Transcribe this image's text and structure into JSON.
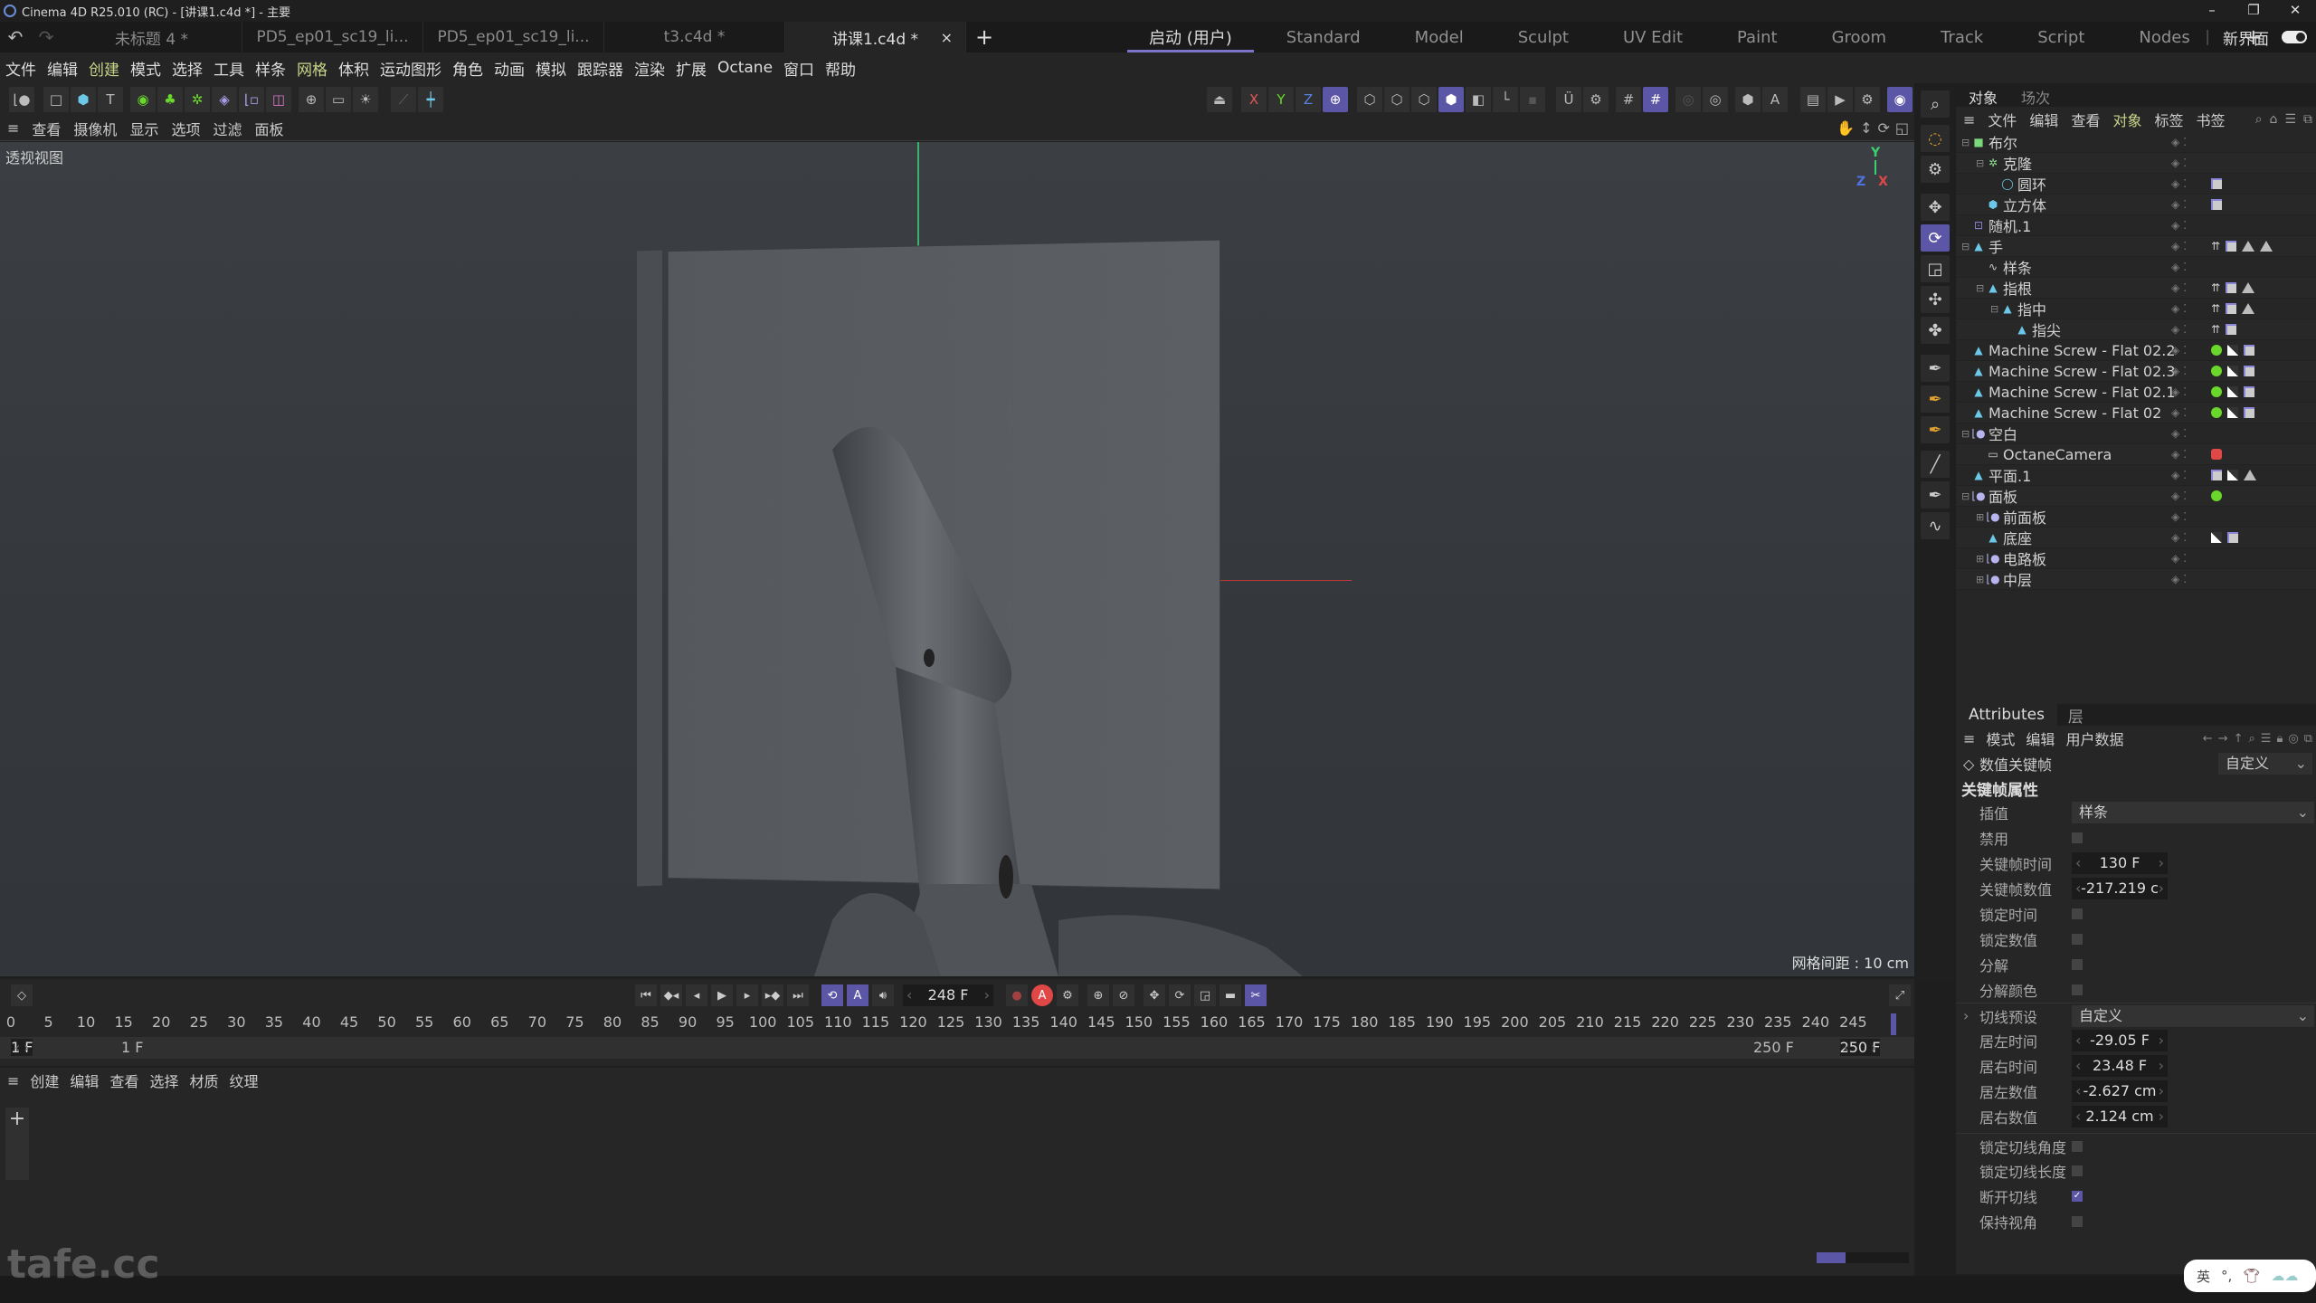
{
  "window": {
    "title": "Cinema 4D R25.010 (RC) - [讲课1.c4d *] - 主要",
    "controls": [
      "minimize",
      "restore",
      "close"
    ]
  },
  "doc_tabs": [
    {
      "label": "未标题 4 *",
      "active": false
    },
    {
      "label": "PD5_ep01_sc19_li...",
      "active": false
    },
    {
      "label": "PD5_ep01_sc19_li...",
      "active": false
    },
    {
      "label": "t3.c4d *",
      "active": false
    },
    {
      "label": "讲课1.c4d *",
      "active": true
    }
  ],
  "layouts": [
    {
      "label": "启动 (用户)",
      "active": true
    },
    {
      "label": "Standard"
    },
    {
      "label": "Model"
    },
    {
      "label": "Sculpt"
    },
    {
      "label": "UV Edit"
    },
    {
      "label": "Paint"
    },
    {
      "label": "Groom"
    },
    {
      "label": "Track"
    },
    {
      "label": "Script"
    },
    {
      "label": "Nodes"
    }
  ],
  "new_ui_label": "新界面",
  "menubar": [
    "文件",
    "编辑",
    "创建",
    "模式",
    "选择",
    "工具",
    "样条",
    "网格",
    "体积",
    "运动图形",
    "角色",
    "动画",
    "模拟",
    "跟踪器",
    "渲染",
    "扩展",
    "Octane",
    "窗口",
    "帮助"
  ],
  "viewport_menu": [
    "查看",
    "摄像机",
    "显示",
    "选项",
    "过滤",
    "面板"
  ],
  "viewport": {
    "name": "透视视图",
    "grid_spacing": "网格间距 : 10 cm",
    "axes": {
      "x": "X",
      "y": "Y",
      "z": "Z"
    }
  },
  "object_manager": {
    "tabs": [
      {
        "label": "对象",
        "active": true
      },
      {
        "label": "场次"
      }
    ],
    "menu": [
      "文件",
      "编辑",
      "查看",
      "对象",
      "标签",
      "书签"
    ],
    "objects": [
      {
        "name": "布尔",
        "depth": 0,
        "icon": "boole",
        "expand": "−",
        "tags": []
      },
      {
        "name": "克隆",
        "depth": 1,
        "icon": "cloner",
        "expand": "−",
        "tags": []
      },
      {
        "name": "圆环",
        "depth": 2,
        "icon": "torus",
        "tags": [
          "phong"
        ]
      },
      {
        "name": "立方体",
        "depth": 1,
        "icon": "cube",
        "tags": [
          "phong"
        ]
      },
      {
        "name": "随机.1",
        "depth": 0,
        "icon": "random",
        "tags": []
      },
      {
        "name": "手",
        "depth": 0,
        "icon": "poly",
        "expand": "−",
        "tags": [
          "ik",
          "phong",
          "tri",
          "tri"
        ]
      },
      {
        "name": "样条",
        "depth": 1,
        "icon": "spline",
        "tags": []
      },
      {
        "name": "指根",
        "depth": 1,
        "icon": "poly",
        "expand": "−",
        "tags": [
          "ik",
          "phong",
          "tri"
        ]
      },
      {
        "name": "指中",
        "depth": 2,
        "icon": "poly",
        "expand": "−",
        "tags": [
          "ik",
          "phong",
          "tri"
        ]
      },
      {
        "name": "指尖",
        "depth": 3,
        "icon": "poly",
        "tags": [
          "ik",
          "phong"
        ]
      },
      {
        "name": "Machine Screw - Flat 02.2",
        "depth": 0,
        "icon": "poly",
        "tags": [
          "grn",
          "tex",
          "phong"
        ]
      },
      {
        "name": "Machine Screw - Flat 02.3",
        "depth": 0,
        "icon": "poly",
        "tags": [
          "grn",
          "tex",
          "phong"
        ]
      },
      {
        "name": "Machine Screw - Flat 02.1",
        "depth": 0,
        "icon": "poly",
        "tags": [
          "grn",
          "tex",
          "phong"
        ]
      },
      {
        "name": "Machine Screw - Flat 02",
        "depth": 0,
        "icon": "poly",
        "tags": [
          "grn",
          "tex",
          "phong"
        ]
      },
      {
        "name": "空白",
        "depth": 0,
        "icon": "null",
        "expand": "−",
        "tags": []
      },
      {
        "name": "OctaneCamera",
        "depth": 1,
        "icon": "camera",
        "tags": [
          "cam"
        ]
      },
      {
        "name": "平面.1",
        "depth": 0,
        "icon": "poly",
        "tags": [
          "phong",
          "tex",
          "tri"
        ]
      },
      {
        "name": "面板",
        "depth": 0,
        "icon": "null",
        "expand": "−",
        "tags": [
          "grn"
        ]
      },
      {
        "name": "前面板",
        "depth": 1,
        "icon": "null",
        "expand": "+",
        "tags": []
      },
      {
        "name": "底座",
        "depth": 1,
        "icon": "poly",
        "tags": [
          "tex",
          "phong"
        ]
      },
      {
        "name": "电路板",
        "depth": 1,
        "icon": "null",
        "expand": "+",
        "tags": []
      },
      {
        "name": "中层",
        "depth": 1,
        "icon": "null",
        "expand": "+",
        "tags": []
      }
    ]
  },
  "attributes": {
    "tabs": [
      {
        "label": "Attributes",
        "active": true
      },
      {
        "label": "层"
      }
    ],
    "menu": [
      "模式",
      "编辑",
      "用户数据"
    ],
    "header_label": "数值关键帧",
    "header_preset": "自定义",
    "section_title": "关键帧属性",
    "interpolation": {
      "label": "插值",
      "value": "样条"
    },
    "disable": {
      "label": "禁用",
      "checked": false
    },
    "key_time": {
      "label": "关键帧时间",
      "value": "130 F"
    },
    "key_value": {
      "label": "关键帧数值",
      "value": "-217.219 c"
    },
    "lock_time": {
      "label": "锁定时间",
      "checked": false
    },
    "lock_value": {
      "label": "锁定数值",
      "checked": false
    },
    "break": {
      "label": "分解",
      "checked": false
    },
    "break_color": {
      "label": "分解颜色",
      "checked": false
    },
    "tangent_preset": {
      "label": "切线预设",
      "value": "自定义"
    },
    "left_time": {
      "label": "居左时间",
      "value": "-29.05 F"
    },
    "right_time": {
      "label": "居右时间",
      "value": "23.48 F"
    },
    "left_value": {
      "label": "居左数值",
      "value": "-2.627 cm"
    },
    "right_value": {
      "label": "居右数值",
      "value": "2.124 cm"
    },
    "lock_tan_angle": {
      "label": "锁定切线角度",
      "checked": false
    },
    "lock_tan_length": {
      "label": "锁定切线长度",
      "checked": false
    },
    "break_tangents": {
      "label": "断开切线",
      "checked": true
    },
    "keep_visual_angle": {
      "label": "保持视角",
      "checked": false
    }
  },
  "timeline": {
    "current_frame": "248 F",
    "ruler_ticks": [
      0,
      5,
      10,
      15,
      20,
      25,
      30,
      35,
      40,
      45,
      50,
      55,
      60,
      65,
      70,
      75,
      80,
      85,
      90,
      95,
      100,
      105,
      110,
      115,
      120,
      125,
      130,
      135,
      140,
      145,
      150,
      155,
      160,
      165,
      170,
      175,
      180,
      185,
      190,
      195,
      200,
      205,
      210,
      215,
      220,
      225,
      230,
      235,
      240,
      245
    ],
    "ruler_max": 250,
    "start_frame": "1 F",
    "range_start": "1 F",
    "range_end": "250 F",
    "end_frame": "250 F"
  },
  "material_manager": {
    "menu": [
      "创建",
      "编辑",
      "查看",
      "选择",
      "材质",
      "纹理"
    ]
  },
  "watermark": "tafe.cc",
  "ime": {
    "lang": "英"
  },
  "accent_color": "#5b56a6"
}
